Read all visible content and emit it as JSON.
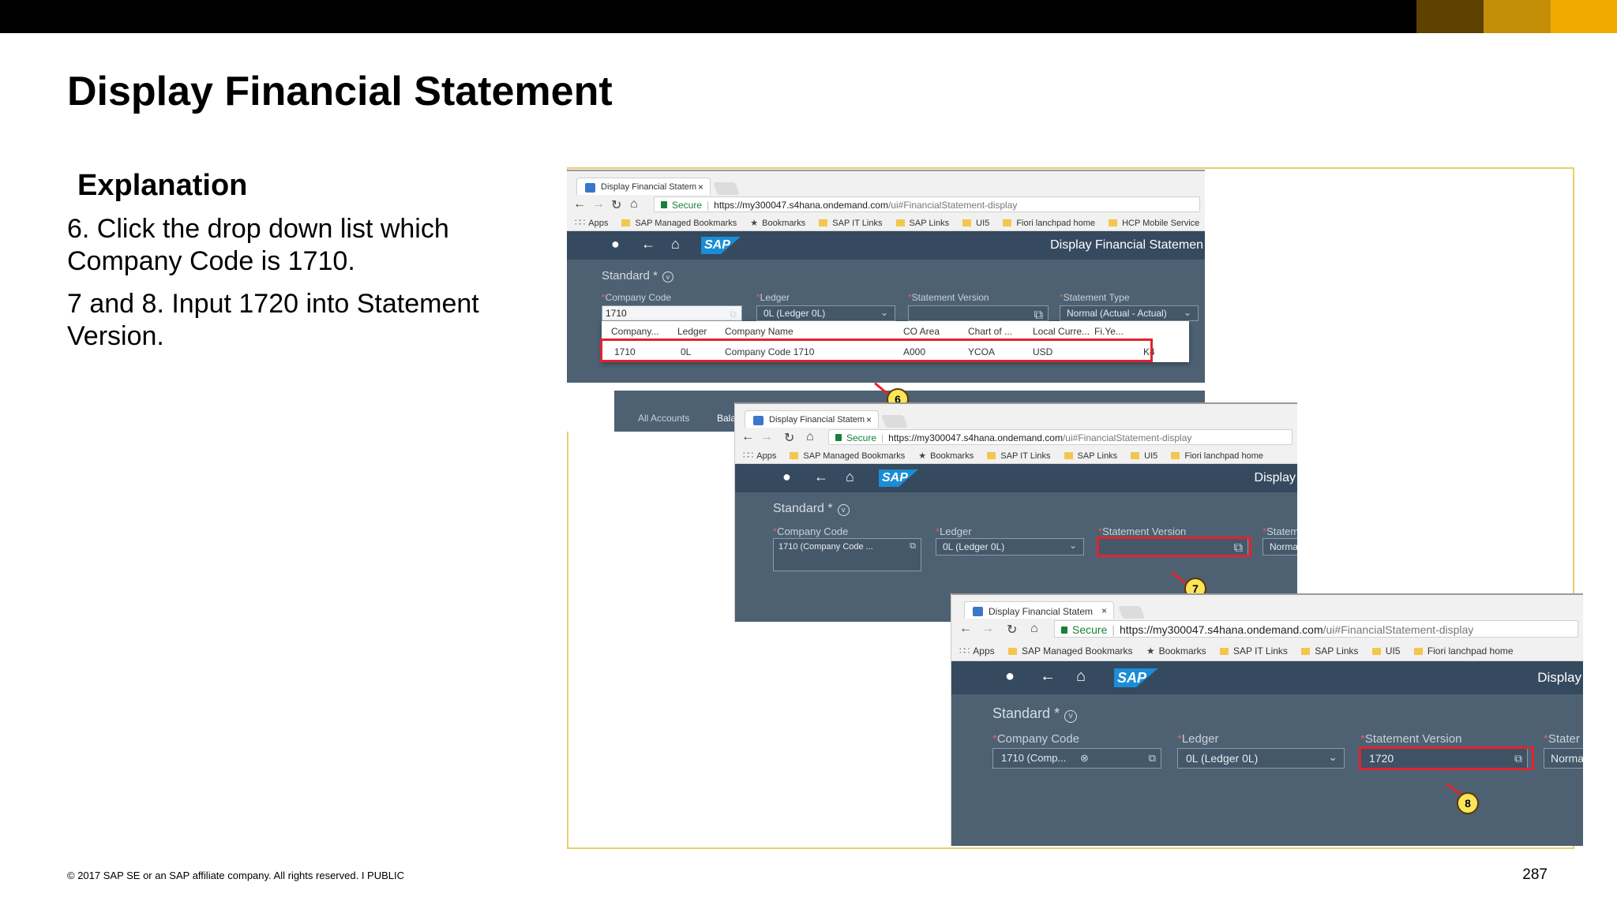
{
  "colors": {
    "top_bar": "#000000",
    "accent_1": "#5c4101",
    "accent_2": "#c48e07",
    "accent_3": "#f0ab00",
    "frame": "#e8cf6a",
    "highlight": "#e0242f",
    "callout": "#fde55a",
    "shell": "#354a5f"
  },
  "slide": {
    "title": "Display Financial Statement",
    "explanation_heading": "Explanation",
    "step_6": "6. Click the drop down list which Company Code is 1710.",
    "step_7_8": "7 and 8. Input 1720 into Statement Version.",
    "copyright": "© 2017 SAP SE or an SAP affiliate company. All rights reserved.   I   PUBLIC",
    "page_number": "287"
  },
  "browser": {
    "tab_title": "Display Financial Statem",
    "secure_label": "Secure",
    "url_host": "https://my300047.s4hana.ondemand.com",
    "url_path": "/ui#FinancialStatement-display",
    "bookmarks": [
      "Apps",
      "SAP Managed Bookmarks",
      "Bookmarks",
      "SAP IT Links",
      "SAP Links",
      "UI5",
      "Fiori lanchpad home",
      "HCP  Mobile Service"
    ]
  },
  "app": {
    "logo": "SAP",
    "shell_title_full": "Display Financial Statemen",
    "shell_title_short": "Display",
    "variant": "Standard",
    "variant_star": "*",
    "labels": {
      "company_code": "Company Code",
      "ledger": "Ledger",
      "statement_version": "Statement Version",
      "statement_type": "Statement Type",
      "statement_type_cut": "Statem",
      "statement_version_cut": "Staten",
      "statement_type_cut_2": "Stater"
    },
    "values": {
      "company_code_typed": "1710",
      "company_code_token_2": "1710 (Company Code ...",
      "company_code_token_3": "1710 (Comp...",
      "ledger": "0L (Ledger 0L)",
      "statement_type": "Normal (Actual - Actual)",
      "statement_type_cut": "Norma",
      "statement_type_cut_2": "Norma",
      "statement_version_input": "1720"
    },
    "popup": {
      "headers": [
        "Company...",
        "Ledger",
        "Company Name",
        "CO Area",
        "Chart of ...",
        "Local Curre...",
        "Fi.Ye..."
      ],
      "row": [
        "1710",
        "0L",
        "Company Code 1710",
        "A000",
        "YCOA",
        "USD",
        "K4"
      ]
    },
    "tabs_below": [
      "All Accounts",
      "Bala"
    ],
    "callouts": [
      "6",
      "7",
      "8"
    ]
  }
}
